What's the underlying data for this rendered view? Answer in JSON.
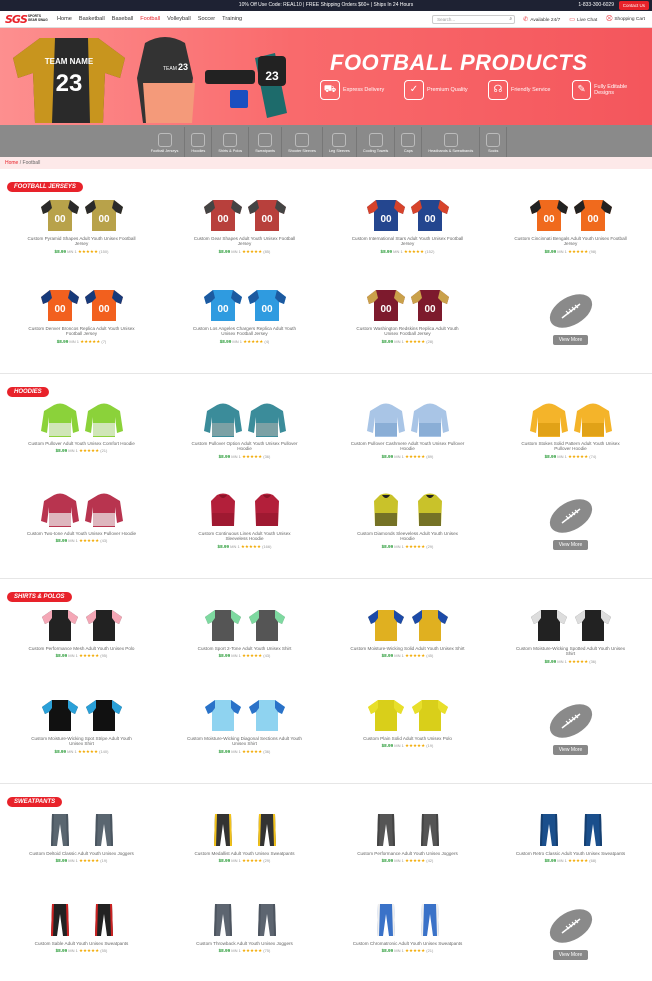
{
  "topbar": {
    "promo": "10% Off Use Code: REAL10 | FREE Shipping Orders $60+ | Ships In 24 Hours",
    "phone": "1-833-300-6029",
    "contact": "Contact Us"
  },
  "nav": {
    "logo": "SGS",
    "logo_sub": "SPORTS GEAR SWAG",
    "menu": [
      "Home",
      "Basketball",
      "Baseball",
      "Football",
      "Volleyball",
      "Soccer",
      "Training"
    ],
    "active": "Football",
    "search_placeholder": "Search...",
    "links": [
      "Available 24/7",
      "Live Chat",
      "Shopping Cart"
    ]
  },
  "banner": {
    "title": "FOOTBALL PRODUCTS",
    "jersey_text": "TEAM NAME",
    "jersey_number": "23",
    "features": [
      "Express Delivery",
      "Premium Quality",
      "Friendly Service",
      "Fully Editable Designs"
    ]
  },
  "categories": [
    "Football Jerseys",
    "Hoodies",
    "Shirts & Polos",
    "Sweatpants",
    "Shooter Sleeves",
    "Leg Sleeves",
    "Cooling Towels",
    "Caps",
    "Headbands & Sweatbands",
    "Socks"
  ],
  "breadcrumb": {
    "home": "Home",
    "current": "Football"
  },
  "common": {
    "price": "$8.99",
    "min": "MN 1",
    "stars": "★★★★★",
    "view_more": "View More"
  },
  "sections": [
    {
      "title": "FOOTBALL JERSEYS",
      "items": [
        {
          "name": "Custom Pyramid Shapes Adult Youth Unisex Football Jersey",
          "reviews": "(150)",
          "colors": [
            "#b8a24a",
            "#2a2a2a"
          ],
          "type": "jersey"
        },
        {
          "name": "Custom Gear Shapes Adult Youth Unisex Football Jersey",
          "reviews": "(85)",
          "colors": [
            "#b8403c",
            "#444"
          ],
          "type": "jersey"
        },
        {
          "name": "Custom International Stars Adult Youth Unisex Football Jersey",
          "reviews": "(152)",
          "colors": [
            "#24468f",
            "#d7432b"
          ],
          "type": "jersey"
        },
        {
          "name": "Custom Cincinnati Bengals Adult Youth Unisex Football Jersey",
          "reviews": "(98)",
          "colors": [
            "#f06a1d",
            "#222"
          ],
          "type": "jersey"
        },
        {
          "name": "Custom Denver Broncos Replica Adult Youth Unisex Football Jersey",
          "reviews": "(7)",
          "colors": [
            "#f2601e",
            "#173a7a"
          ],
          "type": "jersey"
        },
        {
          "name": "Custom Los Angeles Chargers Replica Adult Youth Unisex Football Jersey",
          "reviews": "(4)",
          "colors": [
            "#2f9be0",
            "#1c5aa0"
          ],
          "type": "jersey"
        },
        {
          "name": "Custom Washington Redskins Replica Adult Youth Unisex Football Jersey",
          "reviews": "(28)",
          "colors": [
            "#7d1a2d",
            "#caa14a"
          ],
          "type": "jersey"
        }
      ]
    },
    {
      "title": "HOODIES",
      "items": [
        {
          "name": "Custom Pullover Adult Youth Unisex Comfort Hoodie",
          "reviews": "(21)",
          "colors": [
            "#8bd23a",
            "#eee"
          ],
          "type": "hoodie"
        },
        {
          "name": "Custom Pullover Option Adult Youth Unisex Pullover Hoodie",
          "reviews": "(36)",
          "colors": [
            "#3b8c9a",
            "#9aa"
          ],
          "type": "hoodie"
        },
        {
          "name": "Custom Pullover Cashmere Adult Youth Unisex Pullover Hoodie",
          "reviews": "(89)",
          "colors": [
            "#a9c5e6",
            "#7ea4cf"
          ],
          "type": "hoodie"
        },
        {
          "name": "Custom Stokes Solid Pattern Adult Youth Unisex Pullover Hoodie",
          "reviews": "(74)",
          "colors": [
            "#f4b42a",
            "#d99a10"
          ],
          "type": "hoodie"
        },
        {
          "name": "Custom Two-tone Adult Youth Unisex Pullover Hoodie",
          "reviews": "(43)",
          "colors": [
            "#b8344f",
            "#eee"
          ],
          "type": "hoodie"
        },
        {
          "name": "Custom Continuous Lines Adult Youth Unisex Sleeveless Hoodie",
          "reviews": "(166)",
          "colors": [
            "#b31f3a",
            "#8c1428"
          ],
          "type": "vest"
        },
        {
          "name": "Custom Diamonds Sleeveless Adult Youth Unisex Hoodie",
          "reviews": "(29)",
          "colors": [
            "#c9c22a",
            "#222"
          ],
          "type": "vest"
        }
      ]
    },
    {
      "title": "SHIRTS & POLOS",
      "items": [
        {
          "name": "Custom Performance Mesh Adult Youth Unisex Polo",
          "reviews": "(95)",
          "colors": [
            "#f4a7b6",
            "#222"
          ],
          "type": "shirt"
        },
        {
          "name": "Custom Sport 2-Tone Adult Youth Unisex Shirt",
          "reviews": "(43)",
          "colors": [
            "#7ed9a0",
            "#555"
          ],
          "type": "shirt"
        },
        {
          "name": "Custom Moisture-Wicking Solid Adult Youth Unisex Shirt",
          "reviews": "(45)",
          "colors": [
            "#1c4aa8",
            "#e0b020"
          ],
          "type": "shirt"
        },
        {
          "name": "Custom Moisture-Wicking Spotted Adult Youth Unisex Shirt",
          "reviews": "(36)",
          "colors": [
            "#ddd",
            "#222"
          ],
          "type": "shirt"
        },
        {
          "name": "Custom Moisture-Wicking Spot Stripe Adult Youth Unisex Shirt",
          "reviews": "(140)",
          "colors": [
            "#2aa0d8",
            "#111"
          ],
          "type": "shirt"
        },
        {
          "name": "Custom Moisture-Wicking Diagonal Sections Adult Youth Unisex Shirt",
          "reviews": "(36)",
          "colors": [
            "#2a72c8",
            "#8fd3f0"
          ],
          "type": "shirt"
        },
        {
          "name": "Custom Plain Solid Adult Youth Unisex Polo",
          "reviews": "(19)",
          "colors": [
            "#e8df2a",
            "#d9cf1a"
          ],
          "type": "shirt"
        }
      ]
    },
    {
      "title": "SWEATPANTS",
      "items": [
        {
          "name": "Custom Deltoid Classic Adult Youth Unisex Joggers",
          "reviews": "(19)",
          "colors": [
            "#5a6670",
            "#4a5560"
          ],
          "type": "pants"
        },
        {
          "name": "Custom Medallist Adult Youth Unisex Sweatpants",
          "reviews": "(29)",
          "colors": [
            "#333",
            "#f2c21a"
          ],
          "type": "pants"
        },
        {
          "name": "Custom Performance Adult Youth Unisex Joggers",
          "reviews": "(42)",
          "colors": [
            "#555",
            "#444"
          ],
          "type": "pants"
        },
        {
          "name": "Custom Retro Classic Adult Youth Unisex Sweatpants",
          "reviews": "(68)",
          "colors": [
            "#1a4f8c",
            "#153f70"
          ],
          "type": "pants"
        },
        {
          "name": "Custom Sable Adult Youth Unisex Sweatpants",
          "reviews": "(55)",
          "colors": [
            "#222",
            "#c22"
          ],
          "type": "pants"
        },
        {
          "name": "Custom Throwback Adult Youth Unisex Joggers",
          "reviews": "(75)",
          "colors": [
            "#5d6570",
            "#4d5560"
          ],
          "type": "pants"
        },
        {
          "name": "Custom Chromatronic Adult Youth Unisex Sweatpants",
          "reviews": "(21)",
          "colors": [
            "#3a72c8",
            "#eee"
          ],
          "type": "pants"
        }
      ]
    }
  ]
}
